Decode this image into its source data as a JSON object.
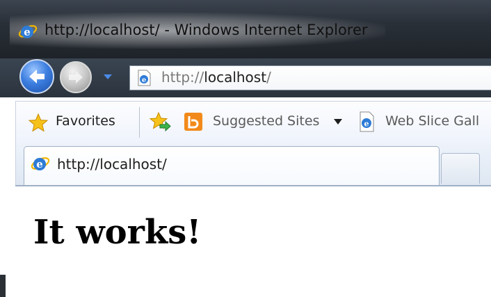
{
  "window": {
    "title": "http://localhost/ - Windows Internet Explorer"
  },
  "navigation": {
    "back_icon": "back-arrow-icon",
    "forward_icon": "forward-arrow-icon",
    "history_dropdown_icon": "chevron-down-icon"
  },
  "address_bar": {
    "prefix": "http://",
    "host": "localhost",
    "suffix": "/"
  },
  "favorites_bar": {
    "favorites_label": "Favorites",
    "suggested_sites_label": "Suggested Sites",
    "web_slice_label": "Web Slice Gall"
  },
  "tabs": [
    {
      "label": "http://localhost/",
      "active": true
    }
  ],
  "page": {
    "heading": "It works!"
  },
  "colors": {
    "chrome_dark": "#2b333d",
    "toolbar_light": "#eef3fb",
    "ie_blue": "#3d7fe0"
  }
}
